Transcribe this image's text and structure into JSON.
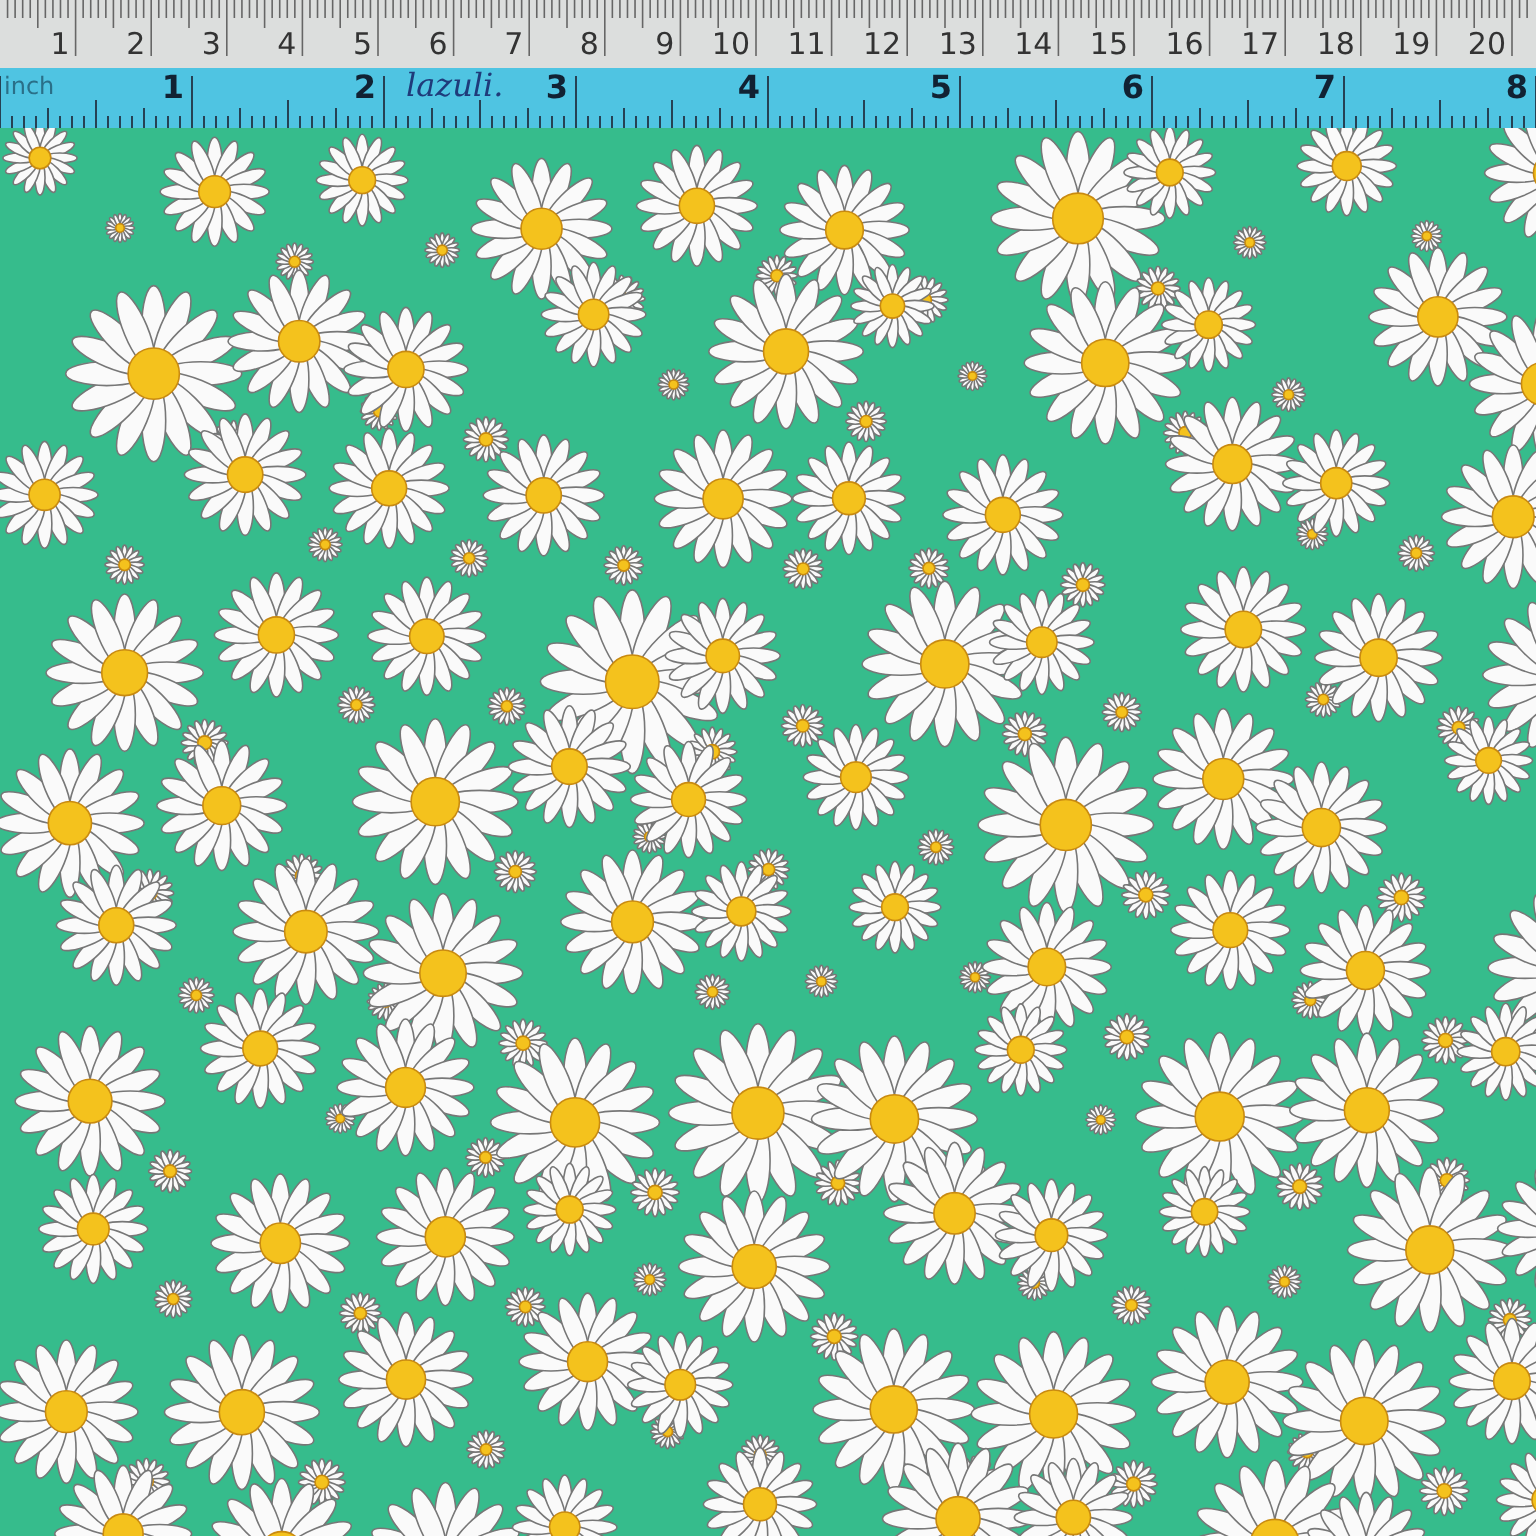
{
  "cm_ruler": {
    "labels": [
      "1",
      "2",
      "3",
      "4",
      "5",
      "6",
      "7",
      "8",
      "9",
      "10",
      "11",
      "12",
      "13",
      "14",
      "15",
      "16",
      "17",
      "18",
      "19",
      "20"
    ]
  },
  "inch_ruler": {
    "unit_label": "inch",
    "labels": [
      "1",
      "2",
      "3",
      "4",
      "5",
      "6",
      "7",
      "8"
    ],
    "note": "lazuli."
  }
}
